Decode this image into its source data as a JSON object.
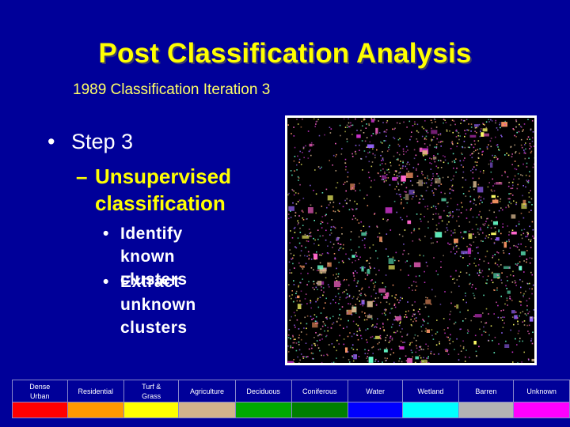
{
  "slide": {
    "title": "Post Classification Analysis",
    "subtitle": "1989 Classification Iteration 3",
    "background_color": "#000099"
  },
  "bullets": {
    "level1": {
      "marker": "•",
      "text": "Step 3"
    },
    "level2": {
      "marker": "–",
      "lines": [
        "Unsupervised",
        "classification"
      ]
    },
    "level3": [
      {
        "marker": "•",
        "lines": [
          "Identify known",
          "clusters"
        ]
      },
      {
        "marker": "•",
        "lines": [
          "Extract unknown",
          "clusters"
        ]
      }
    ]
  },
  "image": {
    "description": "Unsupervised classification map (1989, iteration 3)",
    "speckle_colors": [
      "#d2b48c",
      "#ff66cc",
      "#cc33cc",
      "#ffff66",
      "#66ffcc",
      "#ff9966",
      "#9966ff"
    ]
  },
  "legend": {
    "classes": [
      {
        "label_lines": [
          "Dense",
          "Urban"
        ],
        "color": "#ff0000"
      },
      {
        "label_lines": [
          "Residential"
        ],
        "color": "#ff9900"
      },
      {
        "label_lines": [
          "Turf &",
          "Grass"
        ],
        "color": "#ffff00"
      },
      {
        "label_lines": [
          "Agriculture"
        ],
        "color": "#d2b48c"
      },
      {
        "label_lines": [
          "Deciduous"
        ],
        "color": "#00aa00"
      },
      {
        "label_lines": [
          "Coniferous"
        ],
        "color": "#007f00"
      },
      {
        "label_lines": [
          "Water"
        ],
        "color": "#0000ff"
      },
      {
        "label_lines": [
          "Wetland"
        ],
        "color": "#00ffff"
      },
      {
        "label_lines": [
          "Barren"
        ],
        "color": "#b4b4b4"
      },
      {
        "label_lines": [
          "Unknown"
        ],
        "color": "#ff00ff"
      }
    ]
  }
}
